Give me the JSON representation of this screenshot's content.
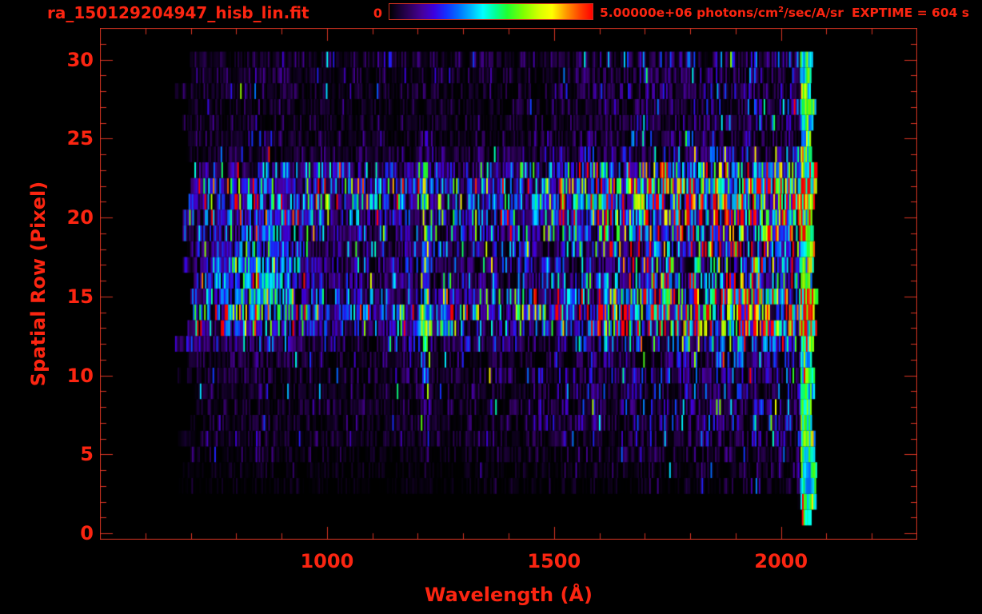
{
  "header": {
    "title": "ra_150129204947_hisb_lin.fit",
    "colorbar": {
      "min_label": "0",
      "max_value": "5.00000e+06",
      "unit_pre": " photons/cm",
      "unit_sup": "2",
      "unit_post": "/sec/A/sr"
    },
    "exptime": "EXPTIME = 604 s"
  },
  "colors": {
    "text": "#fb2511",
    "line": "#d93423",
    "background": "#000000"
  },
  "chart_data": {
    "type": "heatmap",
    "title": "ra_150129204947_hisb_lin.fit",
    "xlabel": "Wavelength (Å)",
    "ylabel": "Spatial Row (Pixel)",
    "xlim": [
      500,
      2300
    ],
    "ylim": [
      -0.4,
      32
    ],
    "x_major_ticks": [
      1000,
      1500,
      2000
    ],
    "x_minor_step": 100,
    "x_minor_range": [
      600,
      2200
    ],
    "y_major_ticks": [
      0,
      5,
      10,
      15,
      20,
      25,
      30
    ],
    "y_minor_step": 1,
    "grid": false,
    "legend": "colorbar-top",
    "colorbar_range": [
      0,
      5000000
    ],
    "colorbar_units": "photons/cm2/sec/A/sr",
    "exposure_seconds": 604,
    "colormap_stops": [
      [
        0.0,
        "#000000"
      ],
      [
        0.05,
        "#180032"
      ],
      [
        0.1,
        "#30005e"
      ],
      [
        0.16,
        "#46009a"
      ],
      [
        0.22,
        "#3c00e0"
      ],
      [
        0.28,
        "#1530ff"
      ],
      [
        0.34,
        "#0070ff"
      ],
      [
        0.4,
        "#00b4ff"
      ],
      [
        0.46,
        "#00ffff"
      ],
      [
        0.52,
        "#00ff9a"
      ],
      [
        0.58,
        "#20ff30"
      ],
      [
        0.66,
        "#80ff00"
      ],
      [
        0.74,
        "#d8ff00"
      ],
      [
        0.8,
        "#ffff00"
      ],
      [
        0.87,
        "#ff9800"
      ],
      [
        0.94,
        "#ff4000"
      ],
      [
        1.0,
        "#ff0000"
      ]
    ],
    "image_model": {
      "seed": 987241,
      "lambda_min": 660,
      "lambda_max": 2078,
      "bin_angstrom": 3.5,
      "row_min": 1,
      "row_max": 30,
      "row_intensity": [
        0,
        0.3,
        0.26,
        0.045,
        0.05,
        0.07,
        0.1,
        0.11,
        0.12,
        0.12,
        0.13,
        0.14,
        0.22,
        0.5,
        0.58,
        0.44,
        0.3,
        0.28,
        0.3,
        0.36,
        0.52,
        0.6,
        0.62,
        0.4,
        0.14,
        0.1,
        0.09,
        0.09,
        0.11,
        0.1,
        0.11
      ],
      "row_gap_prob": [
        1,
        0.5,
        0.5,
        0.55,
        0.5,
        0.42,
        0.32,
        0.33,
        0.32,
        0.33,
        0.3,
        0.3,
        0.26,
        0.16,
        0.15,
        0.17,
        0.2,
        0.2,
        0.2,
        0.17,
        0.13,
        0.12,
        0.12,
        0.16,
        0.26,
        0.3,
        0.32,
        0.32,
        0.3,
        0.32,
        0.28
      ],
      "special_row_lo": {
        "1": 2046,
        "2": 2036
      },
      "spectrum_envelope": [
        [
          655,
          0.32
        ],
        [
          750,
          0.4
        ],
        [
          870,
          0.42
        ],
        [
          1000,
          0.34
        ],
        [
          1150,
          0.36
        ],
        [
          1300,
          0.4
        ],
        [
          1450,
          0.46
        ],
        [
          1550,
          0.58
        ],
        [
          1650,
          0.75
        ],
        [
          1750,
          0.92
        ],
        [
          1850,
          1.0
        ],
        [
          2000,
          1.02
        ],
        [
          2080,
          1.05
        ]
      ],
      "emission_line": {
        "center": 1216,
        "sigma": 5.5,
        "boost": 3.3,
        "row_lo": 5,
        "row_hi": 24,
        "cap": 0.66
      },
      "blob": {
        "lambda_center": 845,
        "lambda_sigma": 68,
        "row_center": 16,
        "row_sigma": 2.3,
        "amplitude": 0.24
      },
      "edge_strip": {
        "lambda_start": 2042,
        "gain": 1.35,
        "spike_prob": 0.05
      },
      "noise_sigma": 0.8
    }
  }
}
